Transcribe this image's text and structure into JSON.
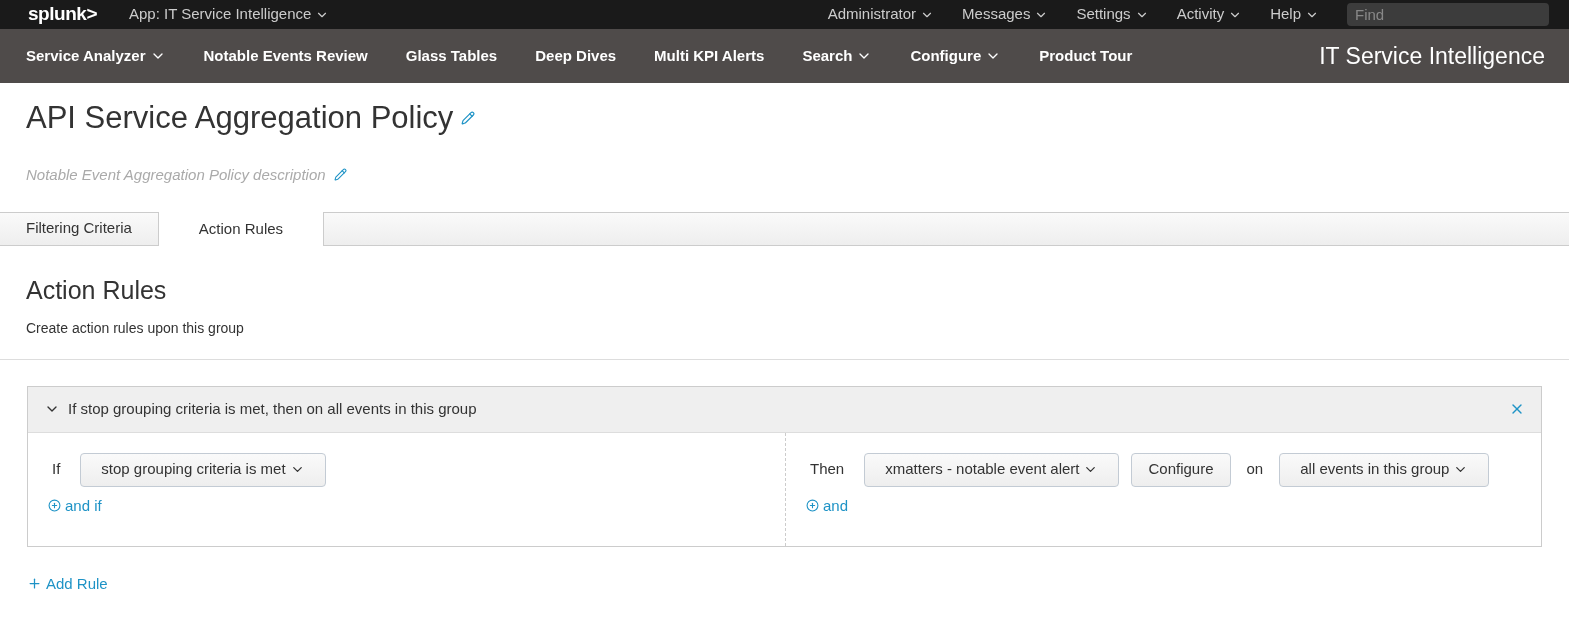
{
  "top_bar": {
    "logo": "splunk>",
    "app": "App: IT Service Intelligence",
    "menus": [
      {
        "label": "Administrator"
      },
      {
        "label": "Messages"
      },
      {
        "label": "Settings"
      },
      {
        "label": "Activity"
      },
      {
        "label": "Help"
      }
    ],
    "search": {
      "placeholder": "Find"
    }
  },
  "nav_bar": {
    "items": [
      {
        "label": "Service Analyzer",
        "dropdown": true
      },
      {
        "label": "Notable Events Review",
        "dropdown": false
      },
      {
        "label": "Glass Tables",
        "dropdown": false
      },
      {
        "label": "Deep Dives",
        "dropdown": false
      },
      {
        "label": "Multi KPI Alerts",
        "dropdown": false
      },
      {
        "label": "Search",
        "dropdown": true
      },
      {
        "label": "Configure",
        "dropdown": true
      },
      {
        "label": "Product Tour",
        "dropdown": false
      }
    ],
    "app_title": "IT Service Intelligence"
  },
  "page": {
    "title": "API Service Aggregation Policy",
    "description": "Notable Event Aggregation Policy description"
  },
  "tabs": [
    {
      "label": "Filtering Criteria",
      "selected": false
    },
    {
      "label": "Action Rules",
      "selected": true
    }
  ],
  "section": {
    "title": "Action Rules",
    "subtitle": "Create action rules upon this group"
  },
  "rules": [
    {
      "summary": "If stop grouping criteria is met, then on all events in this group",
      "expanded": true,
      "if_label": "If",
      "condition": "stop grouping criteria is met",
      "and_if": "and if",
      "then_label": "Then",
      "action": "xmatters - notable event alert",
      "configure": "Configure",
      "on_label": "on",
      "scope": "all events in this group",
      "and": "and"
    }
  ],
  "add_rule": "Add Rule"
}
